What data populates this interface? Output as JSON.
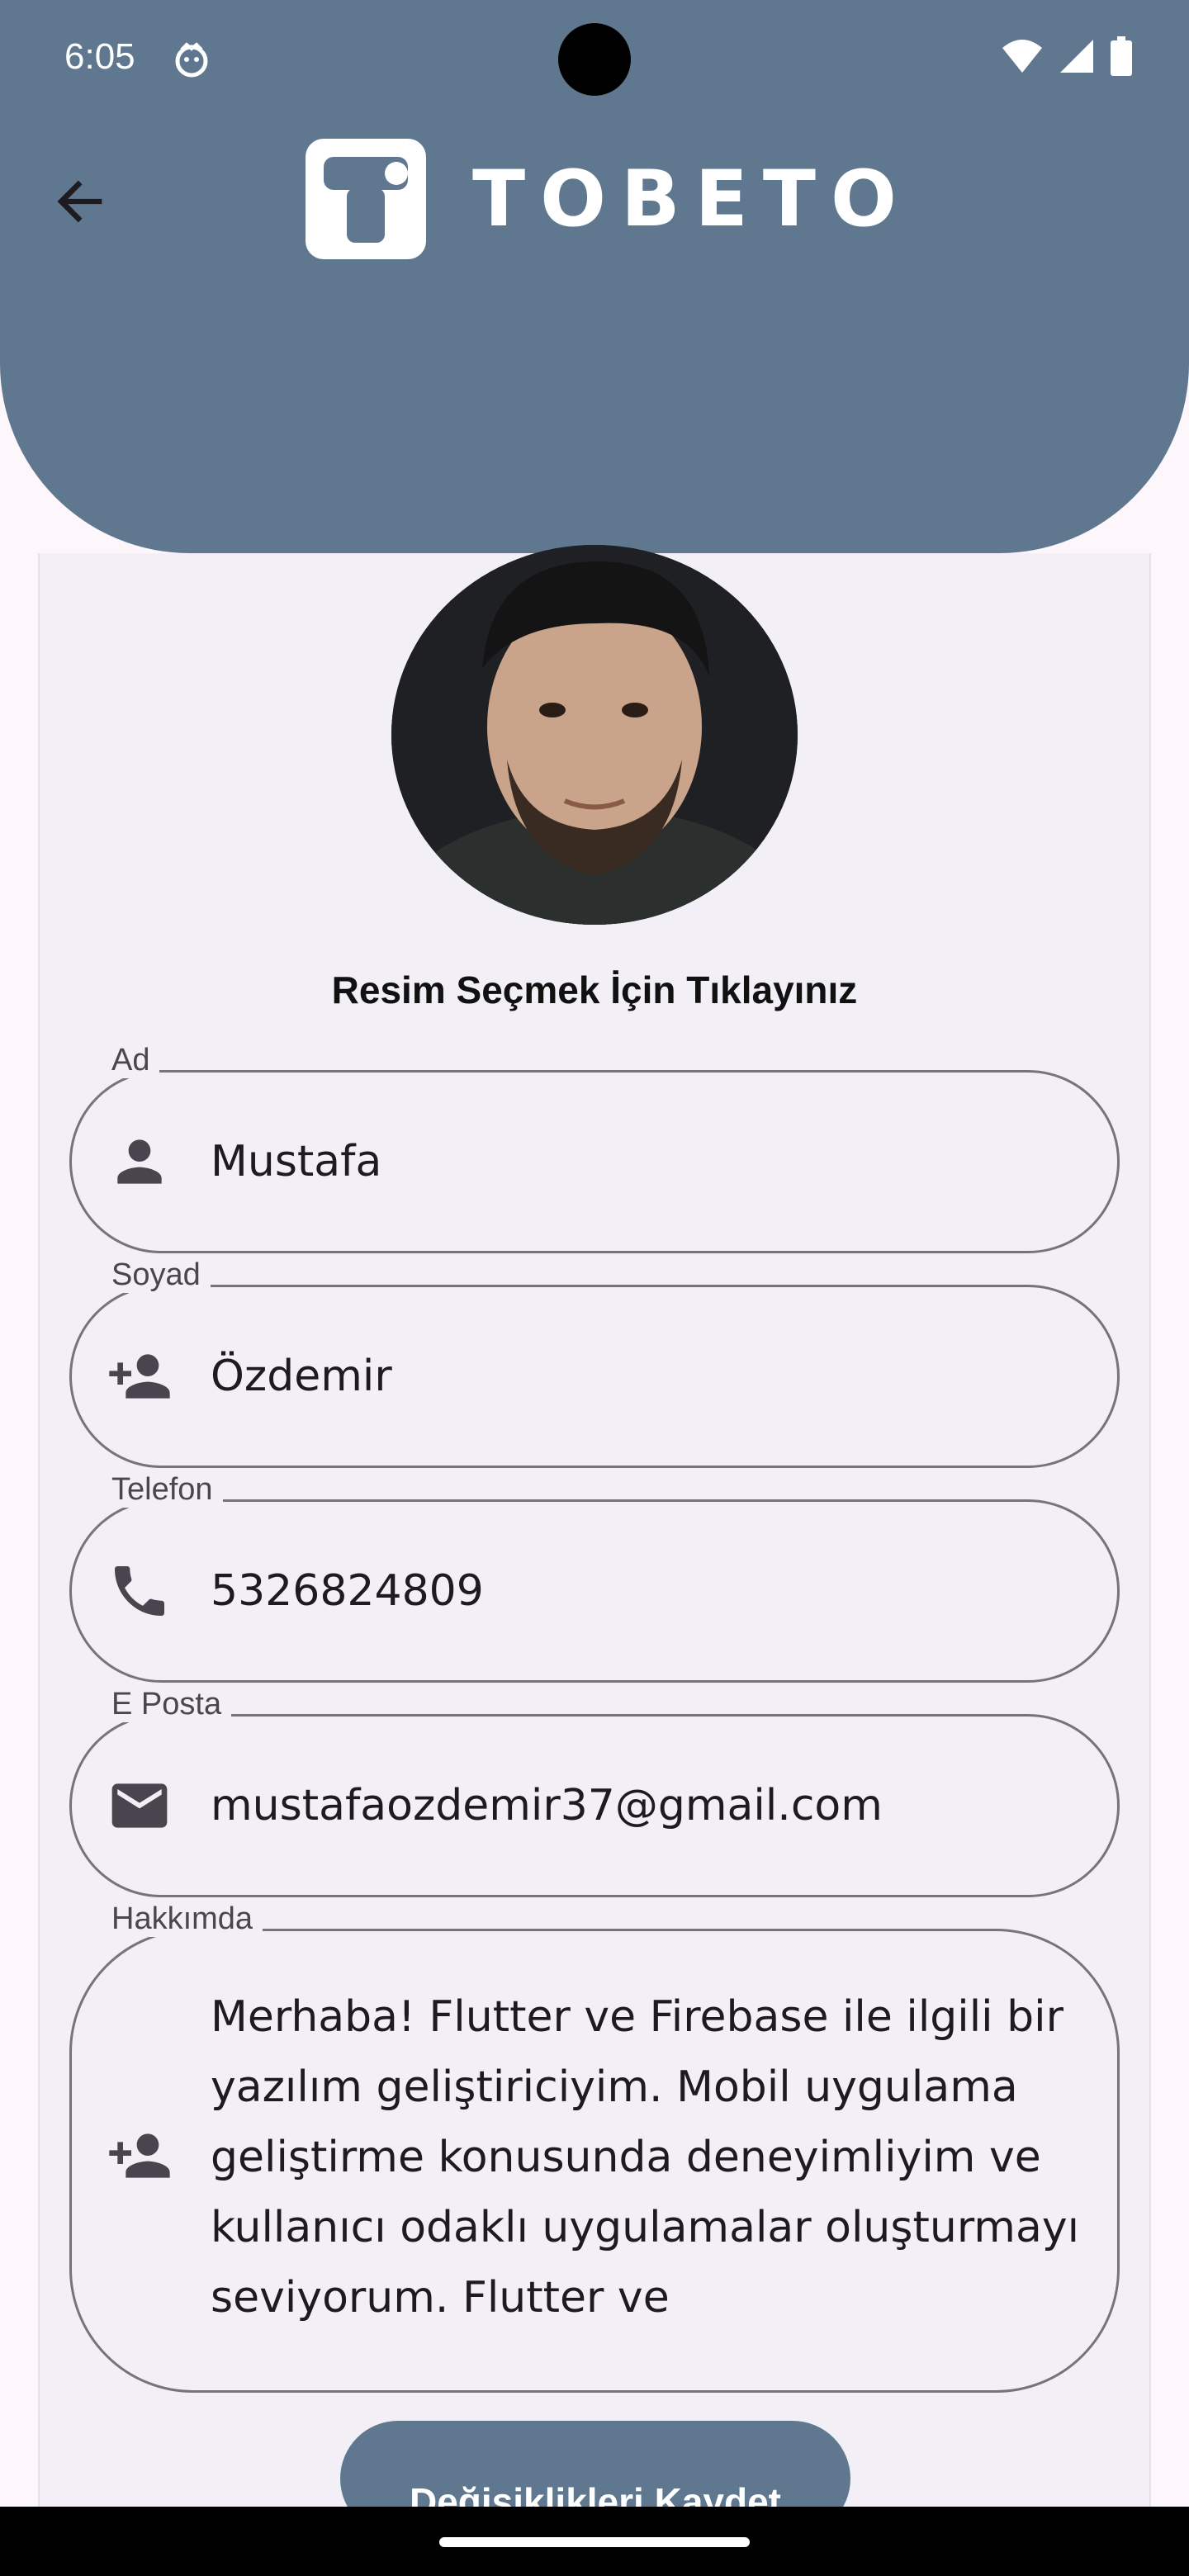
{
  "status_bar": {
    "time": "6:05"
  },
  "header": {
    "logo_text": "TOBETO",
    "background_color": "#5f7890"
  },
  "profile": {
    "pick_image_label": "Resim Seçmek İçin Tıklayınız"
  },
  "form": {
    "first_name": {
      "label": "Ad",
      "value": "Mustafa",
      "icon": "person-icon"
    },
    "last_name": {
      "label": "Soyad",
      "value": "Özdemir",
      "icon": "person-add-icon"
    },
    "phone": {
      "label": "Telefon",
      "value": "5326824809",
      "icon": "phone-icon"
    },
    "email": {
      "label": "E Posta",
      "value": "mustafaozdemir37@gmail.com",
      "icon": "mail-icon"
    },
    "about": {
      "label": "Hakkımda",
      "value": "Merhaba! Flutter ve Firebase ile ilgili bir yazılım geliştiriciyim. Mobil uygulama geliştirme konusunda deneyimliyim ve kullanıcı odaklı uygulamalar oluşturmayı seviyorum. Flutter ve",
      "icon": "person-add-icon"
    }
  },
  "actions": {
    "save_label": "Değişiklikleri Kaydet"
  }
}
